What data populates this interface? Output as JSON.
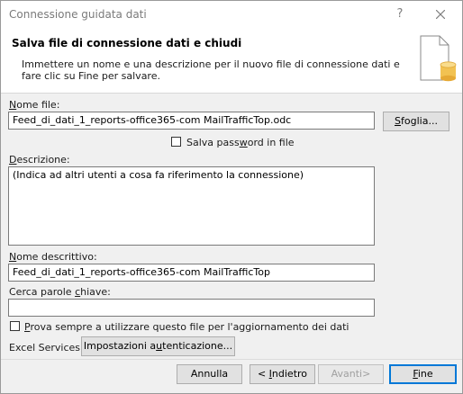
{
  "window": {
    "title": "Connessione guidata dati",
    "help_label": "?",
    "close_icon": "close-icon"
  },
  "header": {
    "title": "Salva file di connessione dati e chiudi",
    "description": "Immettere un nome e una descrizione per il nuovo file di connessione dati e fare clic su Fine per salvare.",
    "icon": "file-database-icon"
  },
  "form": {
    "filename": {
      "label_pre": "",
      "label_key": "N",
      "label_post": "ome file:",
      "value": "Feed_di_dati_1_reports-office365-com MailTrafficTop.odc"
    },
    "browse": {
      "pre": "",
      "key": "S",
      "post": "foglia..."
    },
    "save_password": {
      "label_pre": "Salva pass",
      "label_key": "w",
      "label_post": "ord in file",
      "checked": false
    },
    "description": {
      "label_pre": "",
      "label_key": "D",
      "label_post": "escrizione:",
      "value": "(Indica ad altri utenti a cosa fa riferimento la connessione)"
    },
    "friendly_name": {
      "label_pre": "",
      "label_key": "N",
      "label_post": "ome descrittivo:",
      "value": "Feed_di_dati_1_reports-office365-com MailTrafficTop"
    },
    "keywords": {
      "label_pre": "Cerca parole ",
      "label_key": "c",
      "label_post": "hiave:",
      "value": ""
    },
    "always_use": {
      "label_pre": "",
      "label_key": "P",
      "label_post": "rova sempre a utilizzare questo file per l'aggiornamento dei dati",
      "checked": false
    },
    "excel_services": {
      "label": "Excel Services:",
      "button_pre": "Impostazioni a",
      "button_key": "u",
      "button_post": "tenticazione..."
    }
  },
  "footer": {
    "cancel": "Annulla",
    "back": {
      "pre": "< ",
      "key": "I",
      "post": "ndietro"
    },
    "next": "Avanti>",
    "finish": {
      "pre": "",
      "key": "F",
      "post": "ine"
    }
  }
}
